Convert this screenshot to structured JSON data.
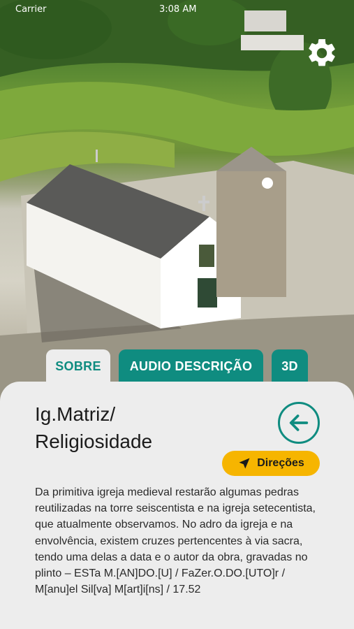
{
  "status_bar": {
    "carrier": "Carrier",
    "time": "3:08 AM"
  },
  "icons": {
    "settings": "gear-icon",
    "back": "arrow-left-icon",
    "directions": "navigation-arrow-icon"
  },
  "colors": {
    "accent": "#0f8c80",
    "directions": "#f6b500",
    "panel": "#ededed"
  },
  "tabs": [
    {
      "label": "SOBRE",
      "active": true
    },
    {
      "label": "AUDIO DESCRIÇÃO",
      "active": false
    },
    {
      "label": "3D",
      "active": false
    }
  ],
  "content": {
    "title": "Ig.Matriz/ Religiosidade",
    "directions_label": "Direções",
    "description": "Da primitiva igreja medieval restarão algumas pedras reutilizadas na torre seiscentista e na igreja setecentista, que atualmente observamos. No adro da igreja e na envolvência, existem cruzes pertencentes à via sacra, tendo uma delas a data e o autor da obra, gravadas no plinto – ESTa M.[AN]DO.[U] / FaZer.O.DO.[UTO]r / M[anu]el Sil[va] M[art]i[ns] / 17.52"
  }
}
